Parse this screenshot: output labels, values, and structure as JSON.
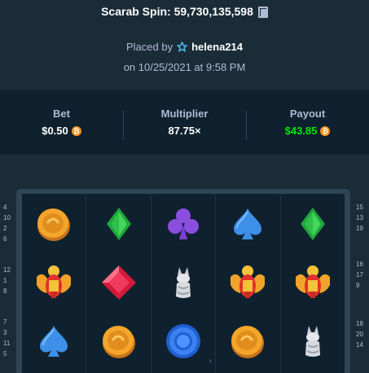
{
  "header": {
    "title": "Scarab Spin: 59,730,135,598",
    "placed_by_label": "Placed by",
    "username": "helena214",
    "date": "on 10/25/2021 at 9:58 PM"
  },
  "stats": {
    "bet_label": "Bet",
    "bet_value": "$0.50",
    "multiplier_label": "Multiplier",
    "multiplier_value": "87.75×",
    "payout_label": "Payout",
    "payout_value": "$43.85",
    "coin_symbol": "₿",
    "coin_color": "#f7931a",
    "payout_color": "#00e701"
  },
  "reels": [
    [
      "gold-coin-icon",
      "scarab-icon",
      "blue-spade-icon"
    ],
    [
      "green-diamond-icon",
      "red-gem-icon",
      "gold-coin-icon"
    ],
    [
      "purple-club-icon",
      "anubis-icon",
      "blue-chip-icon"
    ],
    [
      "blue-spade-icon",
      "scarab-icon",
      "gold-coin-icon"
    ],
    [
      "green-diamond-icon",
      "scarab-icon",
      "anubis-icon"
    ]
  ],
  "paylines": {
    "left": [
      [
        "4",
        "10",
        "2",
        "6"
      ],
      [
        "12",
        "1",
        "8"
      ],
      [
        "7",
        "3",
        "11",
        "5"
      ]
    ],
    "right": [
      [
        "15",
        "13",
        "19"
      ],
      [
        "16",
        "17",
        "9"
      ],
      [
        "18",
        "20",
        "14"
      ]
    ]
  },
  "board_marker": "×"
}
